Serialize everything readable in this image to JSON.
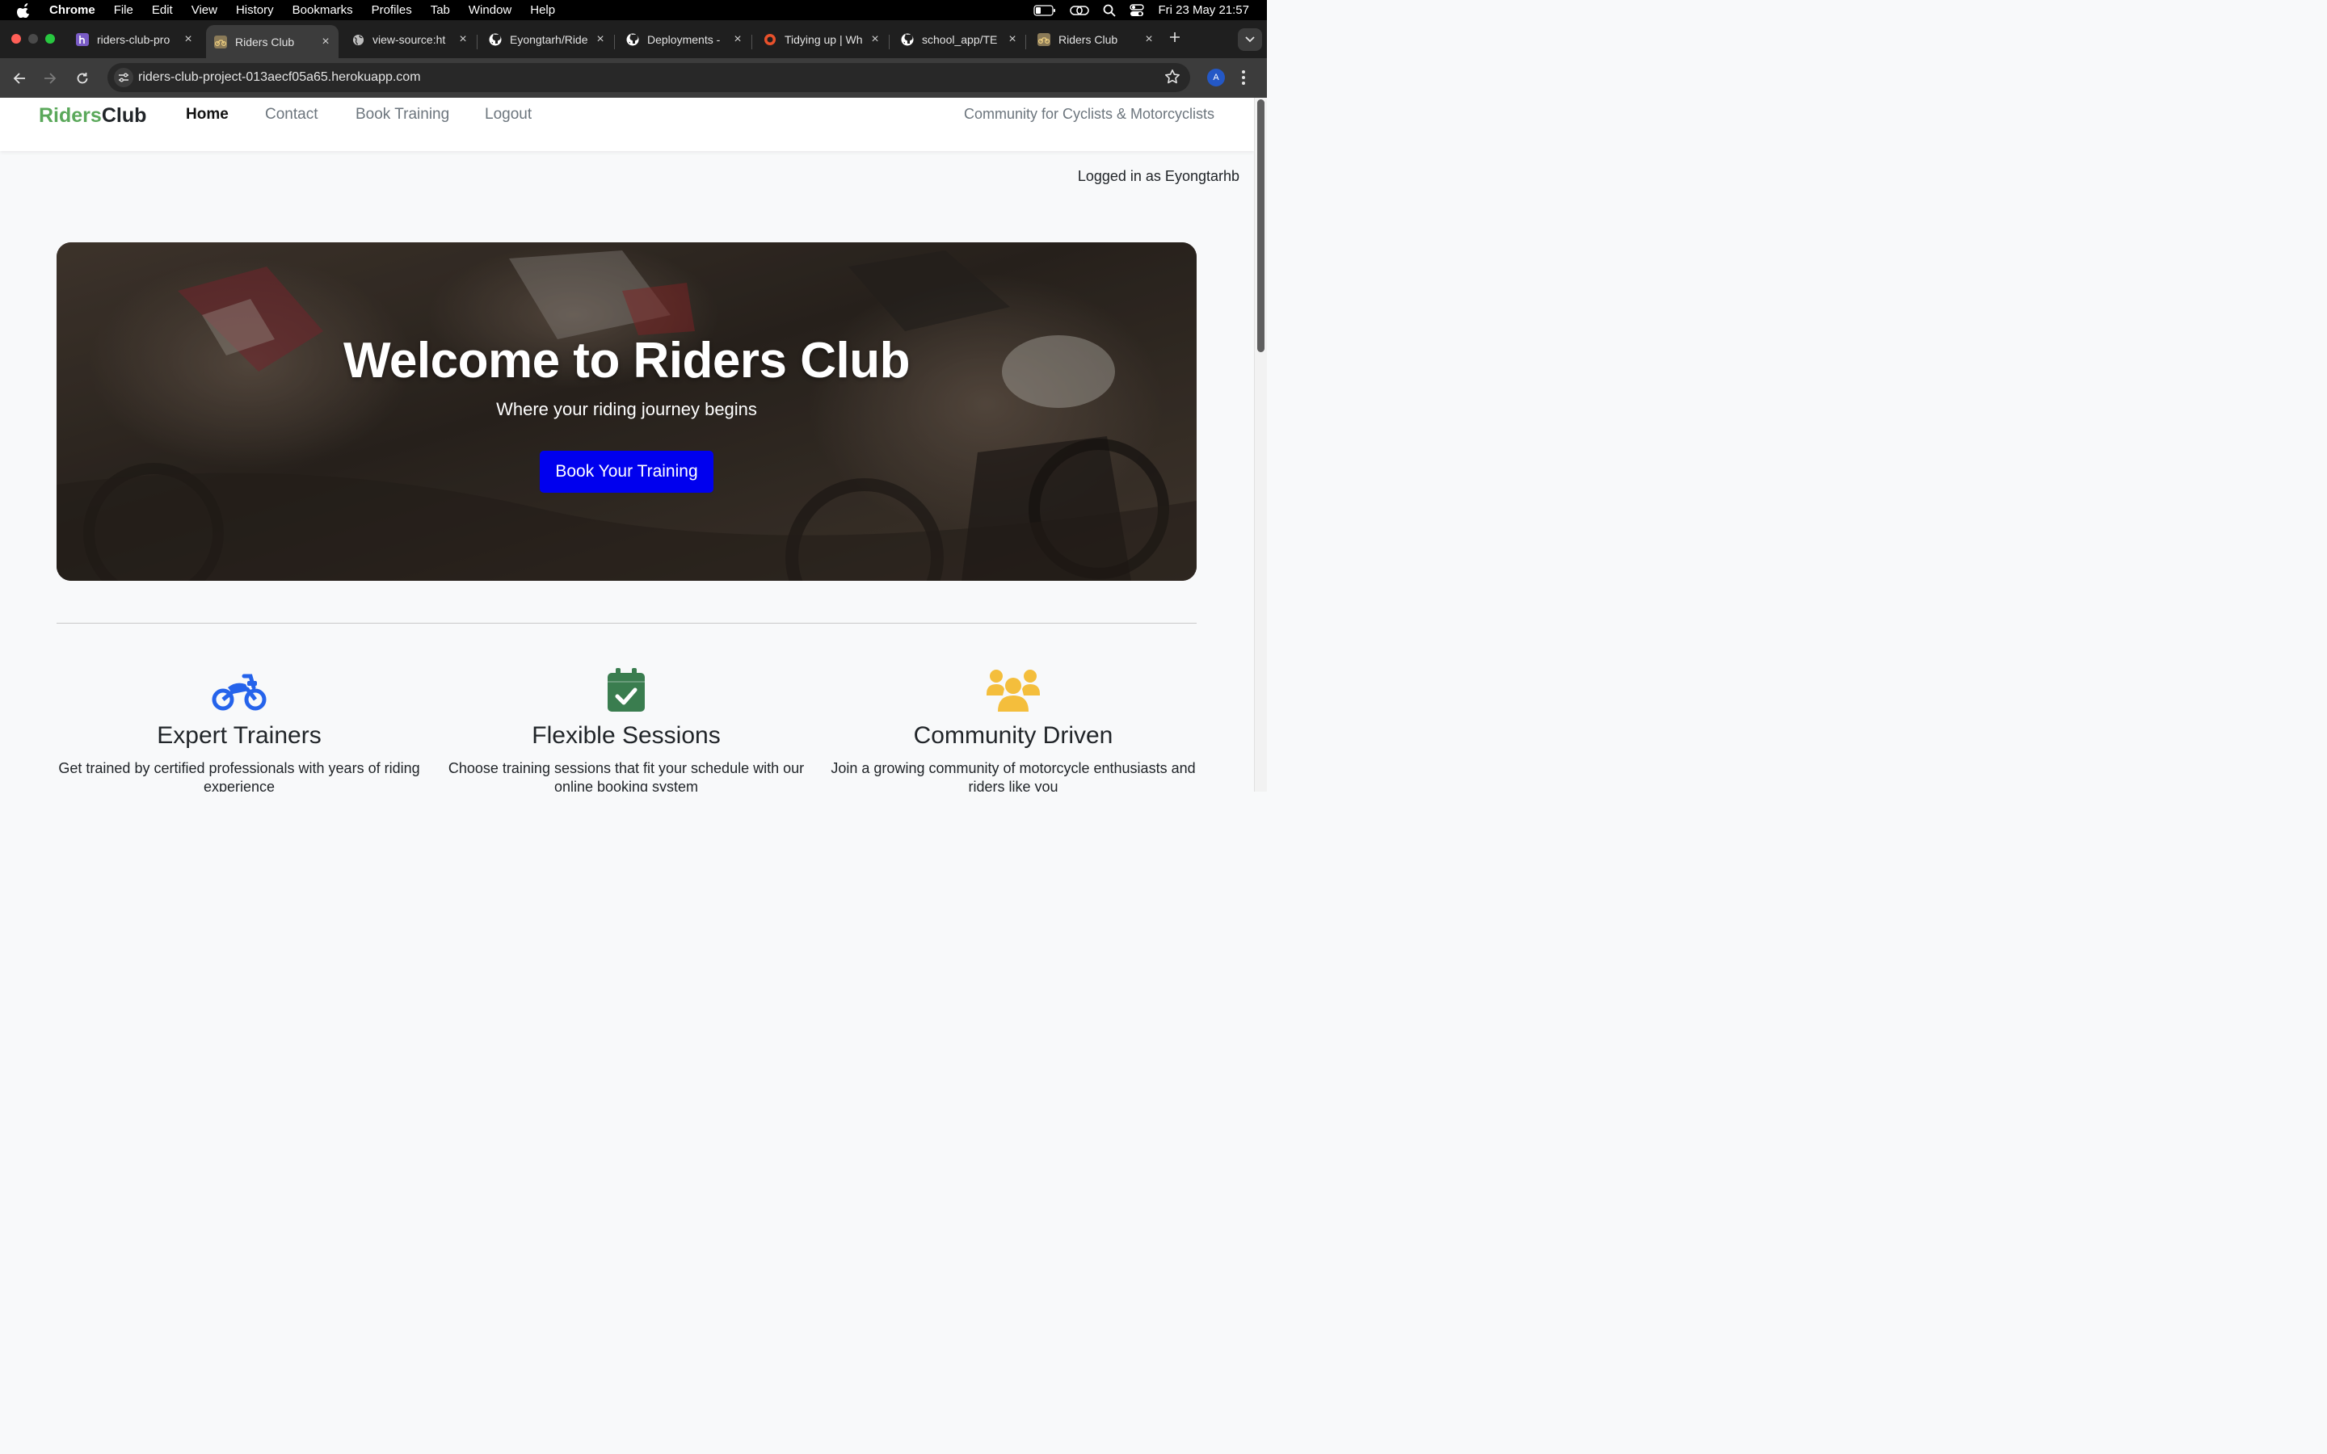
{
  "menubar": {
    "app": "Chrome",
    "items": [
      "File",
      "Edit",
      "View",
      "History",
      "Bookmarks",
      "Profiles",
      "Tab",
      "Window",
      "Help"
    ],
    "clock": "Fri 23 May  21:57"
  },
  "tabs": [
    {
      "title": "riders-club-pro",
      "favicon": "heroku-icon",
      "active": false
    },
    {
      "title": "Riders Club",
      "favicon": "bike-favicon",
      "active": true
    },
    {
      "title": "view-source:ht",
      "favicon": "globe-icon",
      "active": false
    },
    {
      "title": "Eyongtarh/Ride",
      "favicon": "github-icon",
      "active": false
    },
    {
      "title": "Deployments -",
      "favicon": "github-icon",
      "active": false
    },
    {
      "title": "Tidying up | Wh",
      "favicon": "circle-icon",
      "active": false
    },
    {
      "title": "school_app/TE",
      "favicon": "github-icon",
      "active": false
    },
    {
      "title": "Riders Club",
      "favicon": "bike-favicon",
      "active": false
    }
  ],
  "toolbar": {
    "url": "riders-club-project-013aecf05a65.herokuapp.com",
    "profile_initial": "A"
  },
  "site": {
    "brand_part1": "Riders",
    "brand_part2": "Club",
    "brand_colors": {
      "riders": "#5aa85a",
      "club": "#212529"
    },
    "nav": [
      "Home",
      "Contact",
      "Book Training",
      "Logout"
    ],
    "active_nav": "Home",
    "tagline": "Community for Cyclists & Motorcyclists",
    "logged_in": "Logged in as Eyongtarhb"
  },
  "hero": {
    "title": "Welcome to Riders Club",
    "subtitle": "Where your riding journey begins",
    "cta": "Book Your Training",
    "cta_color": "#0000ee"
  },
  "features": [
    {
      "icon": "motorcycle-icon",
      "color": "#2563eb",
      "title": "Expert Trainers",
      "text": "Get trained by certified professionals with years of riding experience"
    },
    {
      "icon": "calendar-check-icon",
      "color": "#3a7d4f",
      "title": "Flexible Sessions",
      "text": "Choose training sessions that fit your schedule with our online booking system"
    },
    {
      "icon": "users-icon",
      "color": "#f4be3c",
      "title": "Community Driven",
      "text": "Join a growing community of motorcycle enthusiasts and riders like you"
    }
  ]
}
